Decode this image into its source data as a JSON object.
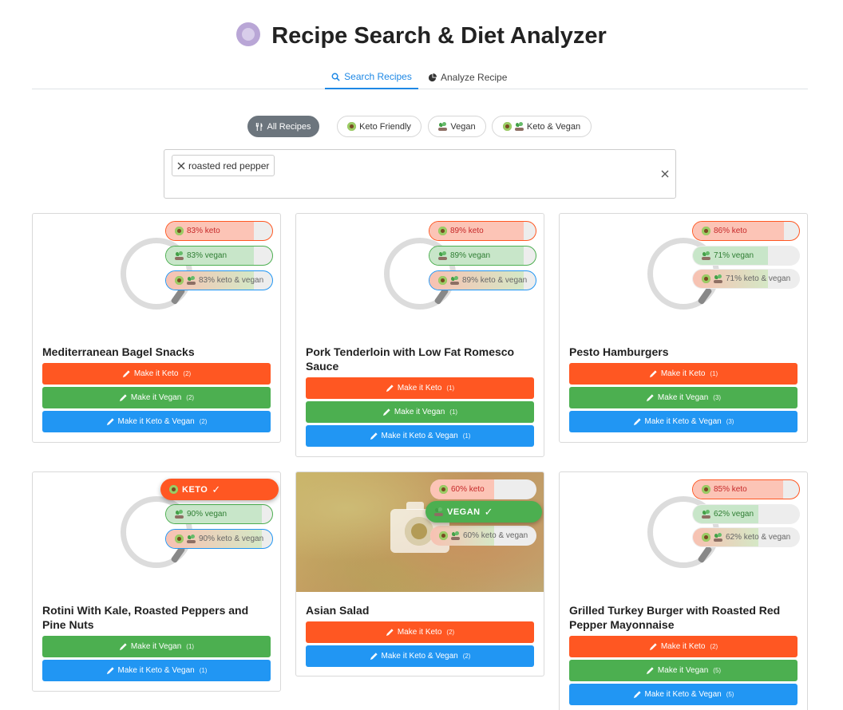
{
  "header": {
    "title": "Recipe Search & Diet Analyzer",
    "icon": "plate-icon"
  },
  "tabs": [
    {
      "label": "Search Recipes",
      "icon": "search-icon",
      "active": true
    },
    {
      "label": "Analyze Recipe",
      "icon": "pie-chart-icon",
      "active": false
    }
  ],
  "filters": [
    {
      "label": "All Recipes",
      "icon": "utensils-icon",
      "active": true
    },
    {
      "label": "Keto Friendly",
      "icon": "avocado-icon",
      "active": false
    },
    {
      "label": "Vegan",
      "icon": "sprout-icon",
      "active": false
    },
    {
      "label": "Keto & Vegan",
      "icon": "avocado-sprout-icon",
      "active": false
    }
  ],
  "search": {
    "chip": "roasted red pepper"
  },
  "colors": {
    "keto": "#ff5722",
    "vegan": "#4caf50",
    "both": "#2196f3",
    "active_tab": "#1e88e5"
  },
  "cards": [
    {
      "name": "Mediterranean Bagel Snacks",
      "keto": {
        "label": "83% keto",
        "pct": 0.83
      },
      "vegan": {
        "label": "83% vegan",
        "pct": 0.83
      },
      "both": {
        "label": "83% keto & vegan",
        "pct": 0.83
      },
      "buttons": [
        {
          "label": "Make it Keto",
          "count": "(2)"
        },
        {
          "label": "Make it Vegan",
          "count": "(2)"
        },
        {
          "label": "Make it Keto & Vegan",
          "count": "(2)"
        }
      ]
    },
    {
      "name": "Pork Tenderloin with Low Fat Romesco Sauce",
      "keto": {
        "label": "89% keto",
        "pct": 0.89
      },
      "vegan": {
        "label": "89% vegan",
        "pct": 0.89
      },
      "both": {
        "label": "89% keto & vegan",
        "pct": 0.89
      },
      "buttons": [
        {
          "label": "Make it Keto",
          "count": "(1)"
        },
        {
          "label": "Make it Vegan",
          "count": "(1)"
        },
        {
          "label": "Make it Keto & Vegan",
          "count": "(1)"
        }
      ]
    },
    {
      "name": "Pesto Hamburgers",
      "keto": {
        "label": "86% keto",
        "pct": 0.86
      },
      "vegan": {
        "label": "71% vegan",
        "pct": 0.71
      },
      "both": {
        "label": "71% keto & vegan",
        "pct": 0.71
      },
      "buttons": [
        {
          "label": "Make it Keto",
          "count": "(1)"
        },
        {
          "label": "Make it Vegan",
          "count": "(3)"
        },
        {
          "label": "Make it Keto & Vegan",
          "count": "(3)"
        }
      ]
    },
    {
      "name": "Rotini With Kale, Roasted Peppers and Pine Nuts",
      "keto_badge": "KETO",
      "vegan": {
        "label": "90% vegan",
        "pct": 0.9
      },
      "both": {
        "label": "90% keto & vegan",
        "pct": 0.9
      },
      "buttons": [
        {
          "label": "Make it Vegan",
          "count": "(1)"
        },
        {
          "label": "Make it Keto & Vegan",
          "count": "(1)"
        }
      ]
    },
    {
      "name": "Asian Salad",
      "keto": {
        "label": "60% keto",
        "pct": 0.6
      },
      "vegan_badge": "VEGAN",
      "both": {
        "label": "60% keto & vegan",
        "pct": 0.6
      },
      "buttons": [
        {
          "label": "Make it Keto",
          "count": "(2)"
        },
        {
          "label": "Make it Keto & Vegan",
          "count": "(2)"
        }
      ]
    },
    {
      "name": "Grilled Turkey Burger with Roasted Red Pepper Mayonnaise",
      "keto": {
        "label": "85% keto",
        "pct": 0.85
      },
      "vegan": {
        "label": "62% vegan",
        "pct": 0.62
      },
      "both": {
        "label": "62% keto & vegan",
        "pct": 0.62
      },
      "buttons": [
        {
          "label": "Make it Keto",
          "count": "(2)"
        },
        {
          "label": "Make it Vegan",
          "count": "(5)"
        },
        {
          "label": "Make it Keto & Vegan",
          "count": "(5)"
        }
      ]
    }
  ]
}
